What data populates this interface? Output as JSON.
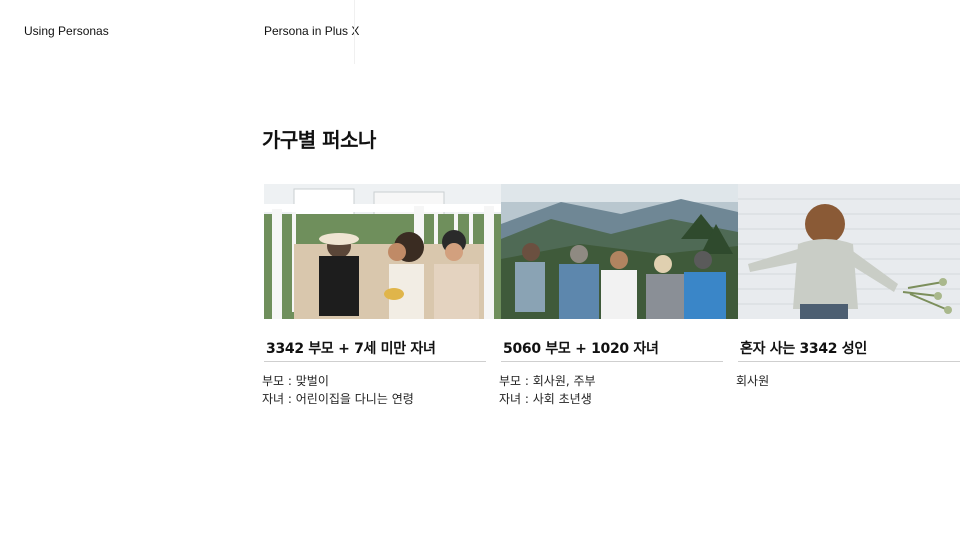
{
  "header": {
    "section_left": "Using Personas",
    "section_right": "Persona in Plus X"
  },
  "page": {
    "title": "가구별 퍼소나"
  },
  "cards": [
    {
      "image": "family-on-porch-photo",
      "heading": "3342 부모 + 7세 미만 자녀",
      "lines": [
        "부모 : 맞벌이",
        "자녀 : 어린이집을 다니는 연령"
      ]
    },
    {
      "image": "family-on-mountain-photo",
      "heading": "5060 부모 + 1020 자녀",
      "lines": [
        "부모 : 회사원, 주부",
        "자녀 : 사회 초년생"
      ]
    },
    {
      "image": "woman-with-flowers-photo",
      "heading": "혼자 사는 3342 성인",
      "lines": [
        "회사원"
      ]
    }
  ]
}
